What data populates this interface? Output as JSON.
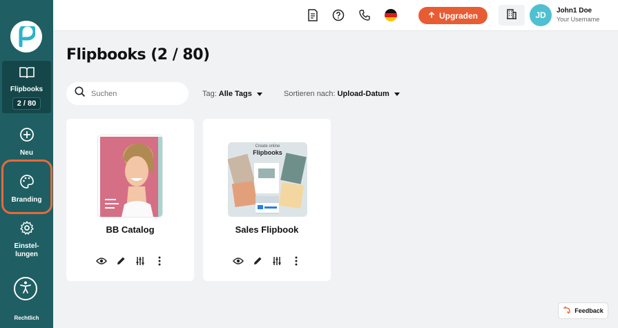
{
  "sidebar": {
    "items": [
      {
        "label": "Flipbooks",
        "badge": "2 / 80",
        "icon": "book-icon",
        "active": true
      },
      {
        "label": "Neu",
        "icon": "plus-circle-icon"
      },
      {
        "label": "Branding",
        "icon": "palette-icon",
        "highlighted": true
      },
      {
        "label": "Einstel-\nlungen",
        "icon": "gear-icon"
      }
    ],
    "accessibility_icon": "accessibility-icon",
    "legal_label": "Rechtlich"
  },
  "topbar": {
    "icons": [
      "document-icon",
      "help-icon",
      "phone-icon",
      "flag-de-icon"
    ],
    "upgrade_label": "Upgraden",
    "org_icon": "building-icon",
    "user": {
      "initials": "JD",
      "name": "John1 Doe",
      "username": "Your Username"
    }
  },
  "main": {
    "title": "Flipbooks (2 / 80)",
    "search": {
      "placeholder": "Suchen",
      "value": ""
    },
    "tag_filter": {
      "label": "Tag:",
      "value": "Alle Tags"
    },
    "sort": {
      "label": "Sortieren nach:",
      "value": "Upload-Datum"
    }
  },
  "cards": [
    {
      "title": "BB Catalog",
      "actions": [
        "eye-icon",
        "pencil-icon",
        "sliders-icon",
        "more-vert-icon"
      ]
    },
    {
      "title": "Sales Flipbook",
      "thumb_caption": "Create online",
      "thumb_title": "Flipbooks",
      "actions": [
        "eye-icon",
        "pencil-icon",
        "sliders-icon",
        "more-vert-icon"
      ]
    }
  ],
  "feedback_label": "Feedback",
  "colors": {
    "sidebar": "#1f5f63",
    "accent": "#e85c33",
    "avatar": "#4fc0d1"
  }
}
